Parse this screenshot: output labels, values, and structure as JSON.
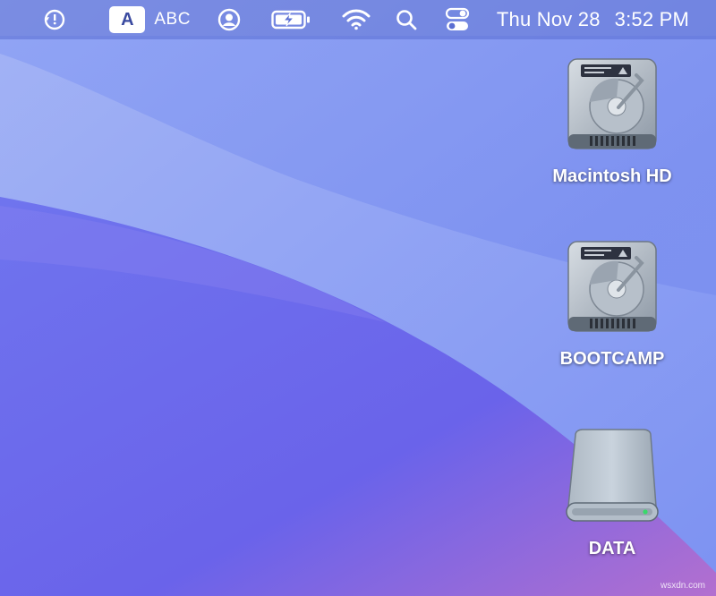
{
  "menubar": {
    "time_machine_icon": "time-machine-icon",
    "input_source_letter": "A",
    "input_source_name": "ABC",
    "user_icon": "user-icon",
    "battery_icon": "battery-charging-icon",
    "wifi_icon": "wifi-icon",
    "search_icon": "search-icon",
    "control_center_icon": "control-center-icon",
    "date": "Thu Nov 28",
    "time": "3:52 PM"
  },
  "desktop": {
    "drives": [
      {
        "label": "Macintosh HD",
        "icon": "hard-drive-icon"
      },
      {
        "label": "BOOTCAMP",
        "icon": "hard-drive-icon"
      },
      {
        "label": "DATA",
        "icon": "external-drive-icon"
      }
    ]
  },
  "watermark": "wsxdn.com",
  "colors": {
    "menubar": "#5a6ed2",
    "wallpaper_top": "#8aa0f0",
    "wallpaper_bottom": "#c07ac8"
  }
}
